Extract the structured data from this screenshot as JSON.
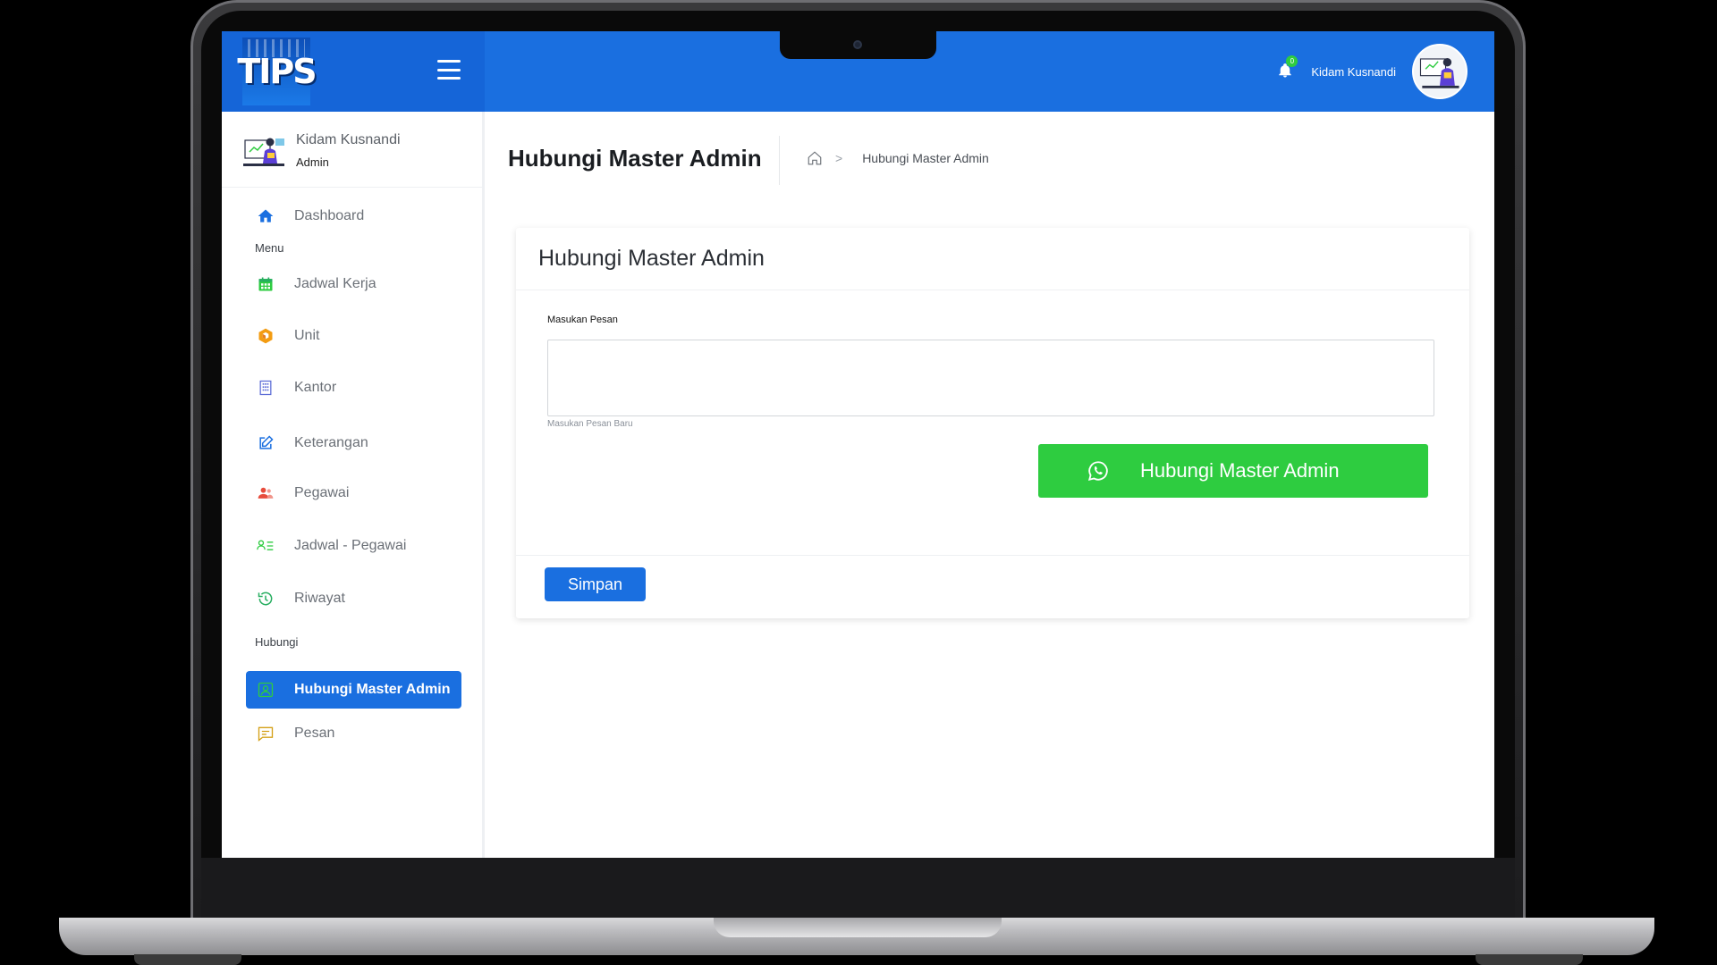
{
  "brand": {
    "logo_text": "TIPS"
  },
  "topbar": {
    "notification_count": "0",
    "username": "Kidam Kusnandi"
  },
  "sidebar": {
    "profile_name": "Kidam Kusnandi",
    "profile_role": "Admin",
    "dashboard_label": "Dashboard",
    "section_menu": "Menu",
    "items": [
      {
        "label": "Jadwal Kerja",
        "icon": "calendar-icon",
        "color": "#2ecc40"
      },
      {
        "label": "Unit",
        "icon": "cube-icon",
        "color": "#f39c12"
      },
      {
        "label": "Kantor",
        "icon": "building-icon",
        "color": "#5b6bd6"
      },
      {
        "label": "Keterangan",
        "icon": "edit-icon",
        "color": "#1a6fe0"
      },
      {
        "label": "Pegawai",
        "icon": "users-icon",
        "color": "#e74c3c"
      },
      {
        "label": "Jadwal - Pegawai",
        "icon": "user-list-icon",
        "color": "#2ecc40"
      },
      {
        "label": "Riwayat",
        "icon": "history-icon",
        "color": "#27ae60"
      }
    ],
    "section_hubungi": "Hubungi",
    "hubungi_items": [
      {
        "label": "Hubungi Master Admin",
        "icon": "contact-icon",
        "active": true
      },
      {
        "label": "Pesan",
        "icon": "message-icon",
        "color": "#d4a017"
      }
    ]
  },
  "main": {
    "page_title": "Hubungi Master Admin",
    "breadcrumb_current": "Hubungi Master Admin",
    "breadcrumb_separator": ">",
    "card_title": "Hubungi Master Admin",
    "field_label": "Masukan Pesan",
    "field_value": "",
    "field_help": "Masukan Pesan Baru",
    "whatsapp_button": "Hubungi Master Admin",
    "save_button": "Simpan"
  },
  "colors": {
    "primary": "#1a6fe0",
    "whatsapp": "#2ecc40"
  }
}
